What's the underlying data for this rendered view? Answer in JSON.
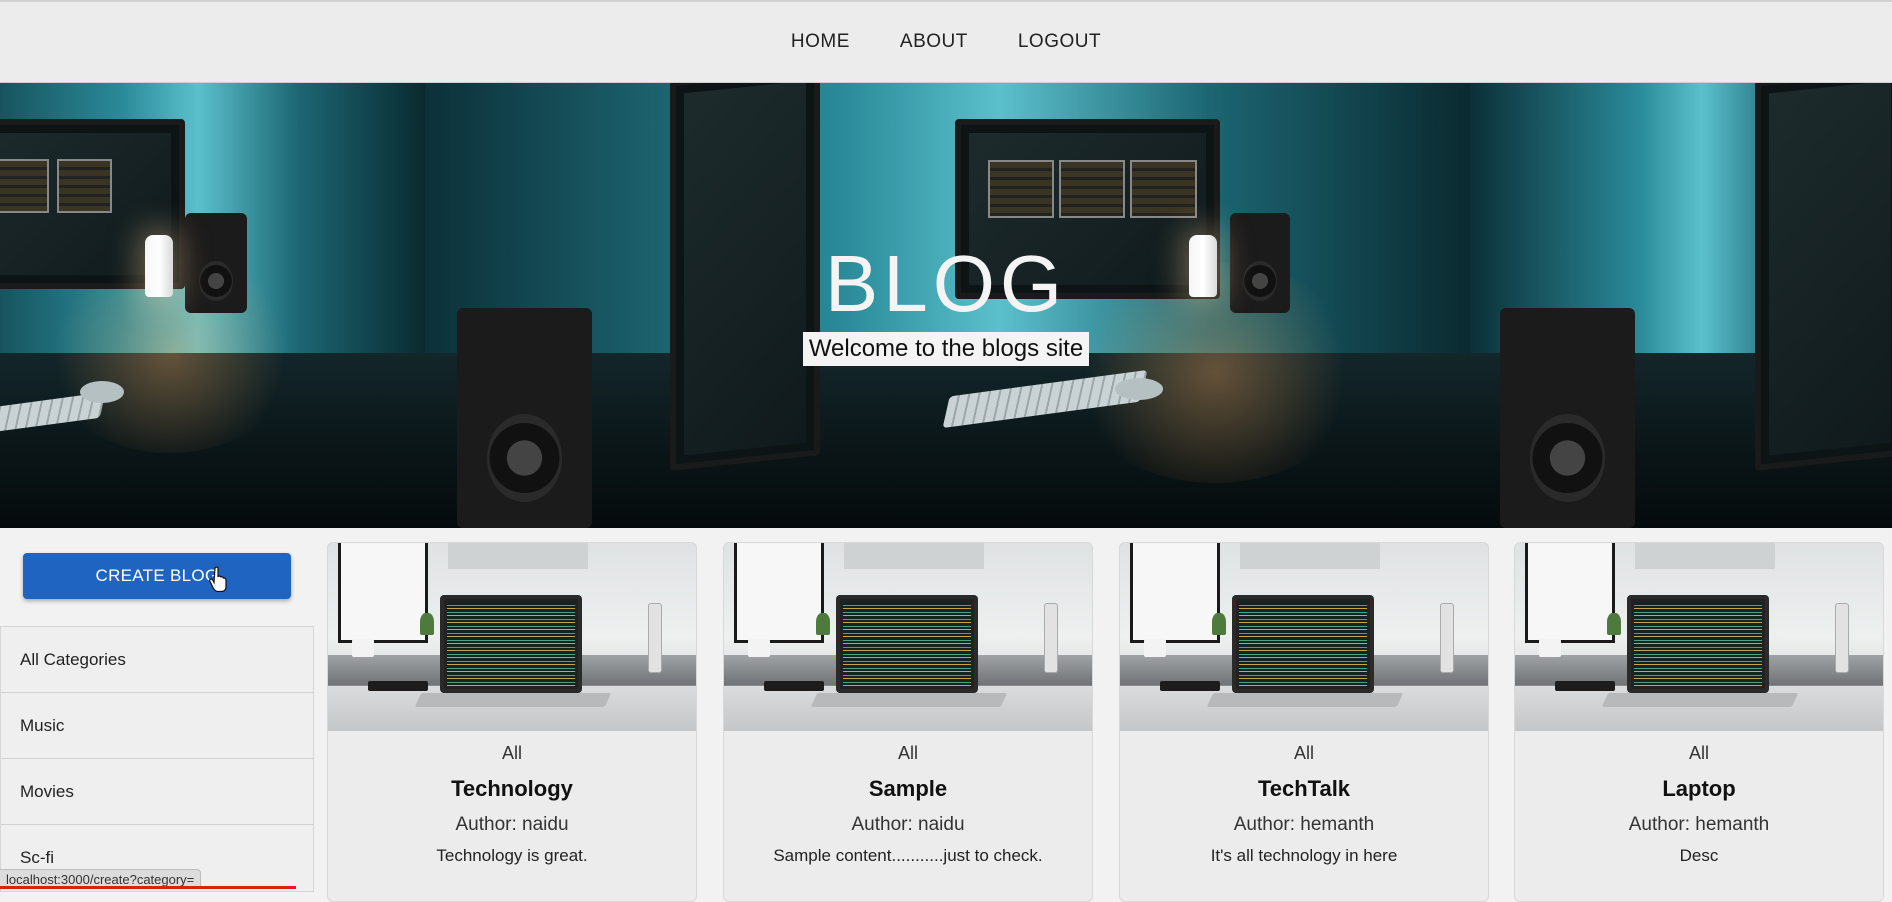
{
  "nav": {
    "links": [
      "HOME",
      "ABOUT",
      "LOGOUT"
    ]
  },
  "hero": {
    "title": "BLOG",
    "subtitle": "Welcome to the blogs site"
  },
  "sidebar": {
    "create_label": "CREATE BLOG",
    "categories": [
      "All Categories",
      "Music",
      "Movies",
      "Sc-fi"
    ]
  },
  "posts": [
    {
      "category": "All",
      "title": "Technology",
      "author": "Author: naidu",
      "description": "Technology is great."
    },
    {
      "category": "All",
      "title": "Sample",
      "author": "Author: naidu",
      "description": "Sample content...........just to check."
    },
    {
      "category": "All",
      "title": "TechTalk",
      "author": "Author: hemanth",
      "description": "It's all technology in here"
    },
    {
      "category": "All",
      "title": "Laptop",
      "author": "Author: hemanth",
      "description": "Desc"
    }
  ],
  "status": {
    "url": "localhost:3000/create?category="
  },
  "colors": {
    "primary_button": "#1f64c0",
    "navbar_bg": "#ececec",
    "progress": "#e21b1b"
  }
}
